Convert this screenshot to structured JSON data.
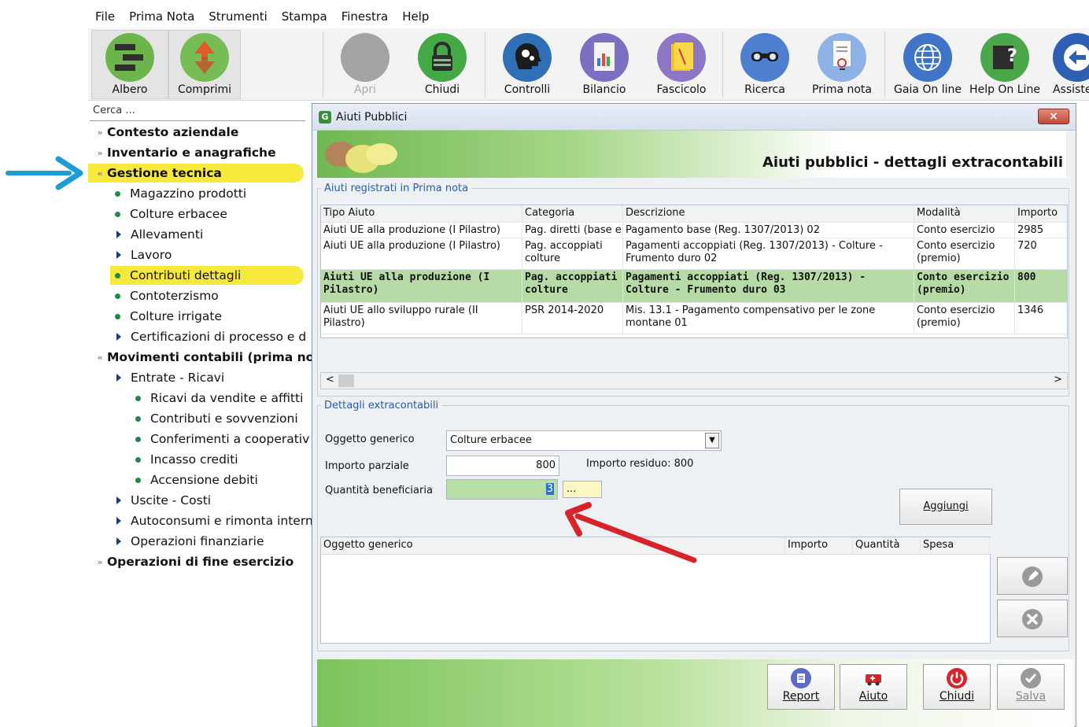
{
  "menu": [
    "File",
    "Prima Nota",
    "Strumenti",
    "Stampa",
    "Finestra",
    "Help"
  ],
  "toolbar": {
    "albero": "Albero",
    "comprimi": "Comprimi",
    "apri": "Apri",
    "chiudi": "Chiudi",
    "controlli": "Controlli",
    "bilancio": "Bilancio",
    "fascicolo": "Fascicolo",
    "ricerca": "Ricerca",
    "prima_nota": "Prima nota",
    "gaia": "Gaia On line",
    "help": "Help On Line",
    "assist": "Assiste"
  },
  "search": {
    "placeholder": "Cerca ..."
  },
  "tree": [
    {
      "label": "Contesto aziendale"
    },
    {
      "label": "Inventario e anagrafiche"
    },
    {
      "label": "Gestione tecnica"
    },
    {
      "label": "Magazzino prodotti"
    },
    {
      "label": "Colture erbacee"
    },
    {
      "label": "Allevamenti"
    },
    {
      "label": "Lavoro"
    },
    {
      "label": "Contributi dettagli"
    },
    {
      "label": "Contoterzismo"
    },
    {
      "label": "Colture irrigate"
    },
    {
      "label": "Certificazioni di processo e d"
    },
    {
      "label": "Movimenti contabili (prima no"
    },
    {
      "label": "Entrate - Ricavi"
    },
    {
      "label": "Ricavi da vendite e affitti"
    },
    {
      "label": "Contributi e sovvenzioni"
    },
    {
      "label": "Conferimenti a cooperativ"
    },
    {
      "label": "Incasso crediti"
    },
    {
      "label": "Accensione debiti"
    },
    {
      "label": "Uscite - Costi"
    },
    {
      "label": "Autoconsumi e rimonta intern"
    },
    {
      "label": "Operazioni finanziarie"
    },
    {
      "label": "Operazioni di fine esercizio"
    }
  ],
  "dialog": {
    "title": "Aiuti Pubblici",
    "close": "×",
    "header_title": "Aiuti pubblici - dettagli extracontabili",
    "legend_registered": "Aiuti registrati in Prima nota",
    "columns": [
      "Tipo Aiuto",
      "Categoria",
      "Descrizione",
      "Modalità",
      "Importo"
    ],
    "rows": [
      {
        "tipo": "Aiuti UE alla produzione (I Pilastro)",
        "cat": "Pag. diretti (base e",
        "desc": "Pagamento base (Reg. 1307/2013) 02",
        "mod": "Conto esercizio",
        "imp": "2985"
      },
      {
        "tipo": "Aiuti UE alla produzione (I Pilastro)",
        "cat": "Pag. accoppiati colture",
        "desc": "Pagamenti accoppiati (Reg. 1307/2013) - Colture - Frumento duro 02",
        "mod": "Conto esercizio (premio)",
        "imp": "720"
      },
      {
        "tipo": "Aiuti UE alla produzione (I Pilastro)",
        "cat": "Pag. accoppiati colture",
        "desc": "Pagamenti accoppiati (Reg. 1307/2013) - Colture - Frumento duro 03",
        "mod": "Conto esercizio (premio)",
        "imp": "800"
      },
      {
        "tipo": "Aiuti UE allo sviluppo rurale (II Pilastro)",
        "cat": "PSR 2014-2020",
        "desc": "Mis. 13.1 - Pagamento compensativo per le zone montane 01",
        "mod": "Conto esercizio (premio)",
        "imp": "1346"
      }
    ],
    "scroll_left": "<",
    "scroll_right": ">",
    "legend_details": "Dettagli extracontabili",
    "oggetto_label": "Oggetto generico",
    "oggetto_value": "Colture erbacee",
    "importo_parziale_label": "Importo parziale",
    "importo_parziale_value": "800",
    "importo_residuo": "Importo residuo: 800",
    "quantita_label": "Quantità beneficiaria",
    "quantita_value": "3",
    "quantita_btn": "...",
    "aggiungi": "Aggiungi",
    "list_columns": [
      "Oggetto generico",
      "Importo",
      "Quantità",
      "Spesa"
    ],
    "footer": {
      "report": "Report",
      "aiuto": "Aiuto",
      "chiudi": "Chiudi",
      "salva": "Salva"
    }
  },
  "colors": {
    "highlight": "#f6e93c",
    "selected_row": "#b7dba6",
    "arrow_blue": "#1d9bd8",
    "arrow_red": "#d8232a"
  }
}
